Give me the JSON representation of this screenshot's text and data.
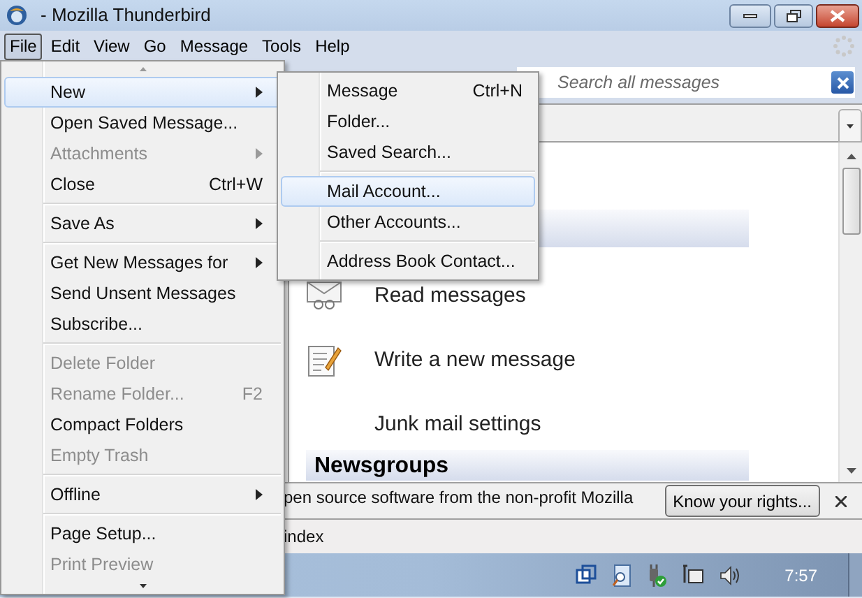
{
  "window": {
    "title": "- Mozilla Thunderbird"
  },
  "menubar": [
    {
      "label": "File",
      "selected": true
    },
    {
      "label": "Edit",
      "selected": false
    },
    {
      "label": "View",
      "selected": false
    },
    {
      "label": "Go",
      "selected": false
    },
    {
      "label": "Message",
      "selected": false
    },
    {
      "label": "Tools",
      "selected": false
    },
    {
      "label": "Help",
      "selected": false
    }
  ],
  "search": {
    "placeholder": "Search all messages"
  },
  "file_menu": [
    {
      "kind": "item",
      "label": "New",
      "submenu": true,
      "disabled": false,
      "selected": true
    },
    {
      "kind": "item",
      "label": "Open Saved Message...",
      "submenu": false,
      "disabled": false,
      "selected": false
    },
    {
      "kind": "item",
      "label": "Attachments",
      "submenu": true,
      "disabled": true,
      "selected": false
    },
    {
      "kind": "item",
      "label": "Close",
      "shortcut": "Ctrl+W",
      "submenu": false,
      "disabled": false,
      "selected": false
    },
    {
      "kind": "separator"
    },
    {
      "kind": "item",
      "label": "Save As",
      "submenu": true,
      "disabled": false,
      "selected": false
    },
    {
      "kind": "separator"
    },
    {
      "kind": "item",
      "label": "Get New Messages for",
      "submenu": true,
      "disabled": false,
      "selected": false
    },
    {
      "kind": "item",
      "label": "Send Unsent Messages",
      "submenu": false,
      "disabled": false,
      "selected": false
    },
    {
      "kind": "item",
      "label": "Subscribe...",
      "submenu": false,
      "disabled": false,
      "selected": false
    },
    {
      "kind": "separator"
    },
    {
      "kind": "item",
      "label": "Delete Folder",
      "submenu": false,
      "disabled": true,
      "selected": false
    },
    {
      "kind": "item",
      "label": "Rename Folder...",
      "shortcut": "F2",
      "submenu": false,
      "disabled": true,
      "selected": false
    },
    {
      "kind": "item",
      "label": "Compact Folders",
      "submenu": false,
      "disabled": false,
      "selected": false
    },
    {
      "kind": "item",
      "label": "Empty Trash",
      "submenu": false,
      "disabled": true,
      "selected": false
    },
    {
      "kind": "separator"
    },
    {
      "kind": "item",
      "label": "Offline",
      "submenu": true,
      "disabled": false,
      "selected": false
    },
    {
      "kind": "separator"
    },
    {
      "kind": "item",
      "label": "Page Setup...",
      "submenu": false,
      "disabled": false,
      "selected": false
    },
    {
      "kind": "item",
      "label": "Print Preview",
      "submenu": false,
      "disabled": true,
      "selected": false
    }
  ],
  "new_submenu": [
    {
      "kind": "item",
      "label": "Message",
      "shortcut": "Ctrl+N",
      "selected": false
    },
    {
      "kind": "item",
      "label": "Folder...",
      "selected": false
    },
    {
      "kind": "item",
      "label": "Saved Search...",
      "selected": false
    },
    {
      "kind": "separator"
    },
    {
      "kind": "item",
      "label": "Mail Account...",
      "selected": true
    },
    {
      "kind": "item",
      "label": "Other Accounts...",
      "selected": false
    },
    {
      "kind": "separator"
    },
    {
      "kind": "item",
      "label": "Address Book Contact...",
      "selected": false
    }
  ],
  "content": {
    "actions": [
      {
        "kind": "read",
        "label": "Read messages"
      },
      {
        "kind": "write",
        "label": "Write a new message"
      },
      {
        "kind": "junk",
        "label": "Junk mail settings"
      }
    ],
    "section": "Newsgroups"
  },
  "notification": {
    "text": "pen source software from the non-profit Mozilla",
    "button": "Know your rights..."
  },
  "status_bar": {
    "text": "index"
  },
  "taskbar": {
    "clock": "7:57"
  }
}
